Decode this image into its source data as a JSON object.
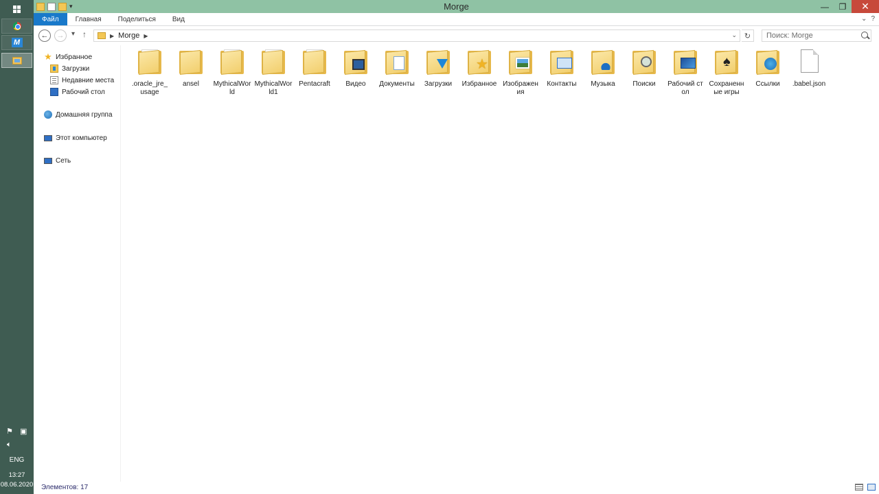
{
  "window": {
    "title": "Morge",
    "colors": {
      "titlebar": "#8fc2a4",
      "taskbar": "#3f5c52",
      "close": "#c7493b",
      "file_tab": "#1979ca"
    }
  },
  "ribbon": {
    "tabs": [
      "Файл",
      "Главная",
      "Поделиться",
      "Вид"
    ]
  },
  "address": {
    "crumb": "Morge",
    "search_placeholder": "Поиск: Morge"
  },
  "nav": {
    "favorites": "Избранное",
    "downloads": "Загрузки",
    "recent": "Недавние места",
    "desktop": "Рабочий стол",
    "homegroup": "Домашняя группа",
    "computer": "Этот компьютер",
    "network": "Сеть"
  },
  "files": [
    {
      "label": ".oracle_jre_usage",
      "icon": "folder-paper-icon"
    },
    {
      "label": "ansel",
      "icon": "folder-icon"
    },
    {
      "label": "MythicalWorld",
      "icon": "folder-paper-icon"
    },
    {
      "label": "MythicalWorld1",
      "icon": "folder-paper-icon"
    },
    {
      "label": "Pentacraft",
      "icon": "folder-paper-icon"
    },
    {
      "label": "Видео",
      "icon": "videos-folder-icon"
    },
    {
      "label": "Документы",
      "icon": "documents-folder-icon"
    },
    {
      "label": "Загрузки",
      "icon": "downloads-folder-icon"
    },
    {
      "label": "Избранное",
      "icon": "favorites-folder-icon"
    },
    {
      "label": "Изображения",
      "icon": "pictures-folder-icon"
    },
    {
      "label": "Контакты",
      "icon": "contacts-folder-icon"
    },
    {
      "label": "Музыка",
      "icon": "music-folder-icon"
    },
    {
      "label": "Поиски",
      "icon": "searches-folder-icon"
    },
    {
      "label": "Рабочий стол",
      "icon": "desktop-folder-icon"
    },
    {
      "label": "Сохраненные игры",
      "icon": "saved-games-folder-icon"
    },
    {
      "label": "Ссылки",
      "icon": "links-folder-icon"
    },
    {
      "label": ".babel.json",
      "icon": "file-icon"
    }
  ],
  "status": {
    "items": "Элементов: 17"
  },
  "taskbar": {
    "language": "ENG",
    "time": "13:27",
    "date": "08.06.2020"
  }
}
